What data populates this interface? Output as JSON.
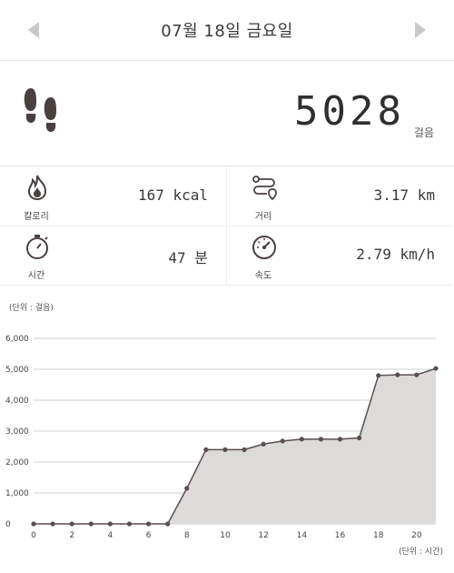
{
  "header": {
    "date_title": "07월 18일 금요일",
    "prev_icon": "chevron-left-icon",
    "next_icon": "chevron-right-icon"
  },
  "steps": {
    "icon": "footprints-icon",
    "value": "5028",
    "unit": "걸음"
  },
  "stats": [
    {
      "icon": "flame-icon",
      "label": "칼로리",
      "value": "167 kcal"
    },
    {
      "icon": "route-icon",
      "label": "거리",
      "value": "3.17 km"
    },
    {
      "icon": "stopwatch-icon",
      "label": "시간",
      "value": "47 분"
    },
    {
      "icon": "speedometer-icon",
      "label": "속도",
      "value": "2.79 km/h"
    }
  ],
  "chart_unit_top": "(단위 : 걸음)",
  "chart_unit_bottom": "(단위 : 시간)",
  "chart_data": {
    "type": "area",
    "title": "",
    "xlabel": "(단위 : 시간)",
    "ylabel": "(단위 : 걸음)",
    "x": [
      0,
      1,
      2,
      3,
      4,
      5,
      6,
      7,
      8,
      9,
      10,
      11,
      12,
      13,
      14,
      15,
      16,
      17,
      18,
      19,
      20,
      21
    ],
    "values": [
      0,
      0,
      0,
      0,
      0,
      0,
      0,
      0,
      1150,
      2400,
      2400,
      2400,
      2580,
      2680,
      2740,
      2740,
      2740,
      2780,
      4800,
      4820,
      4820,
      5028
    ],
    "x_ticks": [
      "0",
      "2",
      "4",
      "6",
      "8",
      "10",
      "12",
      "14",
      "16",
      "18",
      "20"
    ],
    "y_ticks": [
      "0",
      "1,000",
      "2,000",
      "3,000",
      "4,000",
      "5,000",
      "6,000"
    ],
    "xlim": [
      0,
      21
    ],
    "ylim": [
      0,
      6000
    ],
    "grid": true,
    "fill_color": "#dcdbda",
    "line_color": "#5a4e4f"
  }
}
